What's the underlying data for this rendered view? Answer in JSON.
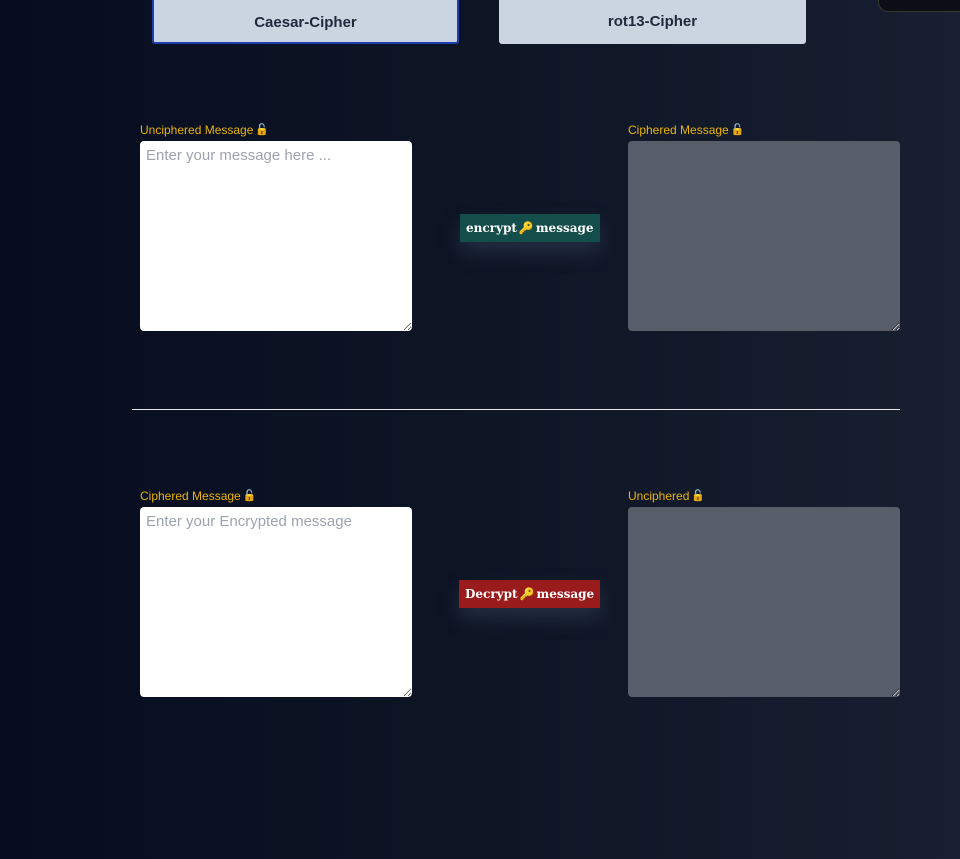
{
  "tabs": [
    {
      "label": "Caesar-Cipher",
      "active": true
    },
    {
      "label": "rot13-Cipher",
      "active": false
    }
  ],
  "encrypt_section": {
    "input_label": "Unciphered Message",
    "input_placeholder": "Enter your message here ...",
    "input_value": "",
    "button_label_left": "encrypt",
    "button_label_right": "message",
    "output_label": "Ciphered Message",
    "output_value": ""
  },
  "decrypt_section": {
    "input_label": "Ciphered Message",
    "input_placeholder": "Enter your Encrypted message",
    "input_value": "",
    "button_label_left": "Decrypt",
    "button_label_right": "message",
    "output_label": "Unciphered",
    "output_value": ""
  },
  "icons": {
    "label_icon": "unlocked-padlock-icon",
    "button_icon": "key-icon"
  },
  "colors": {
    "label": "#eab308",
    "encrypt_button": "#134e4a",
    "decrypt_button": "#991b1b",
    "tab_bg": "#cbd5e1",
    "output_bg": "#575d69"
  }
}
